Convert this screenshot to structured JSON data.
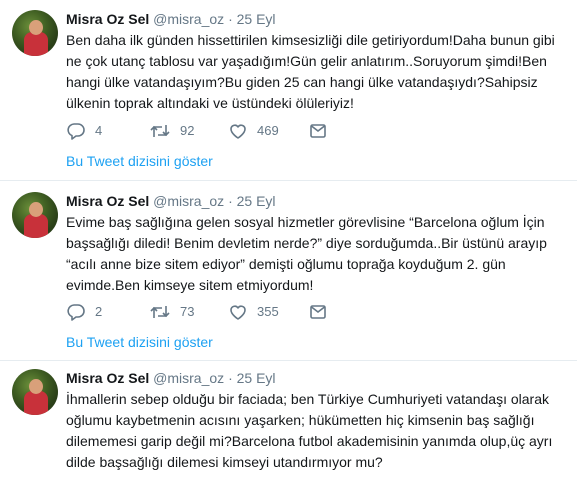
{
  "tweets": [
    {
      "name": "Misra Oz Sel",
      "handle": "@misra_oz",
      "dot": "·",
      "date": "25 Eyl",
      "lines": [
        "Ben daha ilk günden hissettirilen kimsesizliği dile getiriyordum!Daha bunun gibi",
        "ne çok utanç tablosu var yaşadığım!Gün gelir anlatırım..Soruyorum şimdi!Ben",
        "hangi ülke vatandaşıyım?Bu giden 25 can hangi ülke vatandaşıydı?Sahipsiz",
        "ülkenin toprak altındaki ve üstündeki ölüleriyiz!"
      ],
      "replies": "4",
      "retweets": "92",
      "likes": "469",
      "thread_link": "Bu Tweet dizisini göster"
    },
    {
      "name": "Misra Oz Sel",
      "handle": "@misra_oz",
      "dot": "·",
      "date": "25 Eyl",
      "lines": [
        "Evime baş sağlığına gelen sosyal hizmetler görevlisine “Barcelona oğlum İçin",
        "başsağlığı diledi! Benim devletim nerde?” diye sorduğumda..Bir üstünü arayıp",
        "“acılı anne bize sitem ediyor” demişti oğlumu toprağa koyduğum 2. gün",
        "evimde.Ben kimseye sitem etmiyordum!"
      ],
      "replies": "2",
      "retweets": "73",
      "likes": "355",
      "thread_link": "Bu Tweet dizisini göster"
    },
    {
      "name": "Misra Oz Sel",
      "handle": "@misra_oz",
      "dot": "·",
      "date": "25 Eyl",
      "lines": [
        "İhmallerin sebep olduğu bir faciada; ben Türkiye Cumhuriyeti vatandaşı olarak",
        "oğlumu kaybetmenin acısını yaşarken; hükümetten hiç kimsenin baş sağlığı",
        "dilememesi garip değil mi?Barcelona futbol akademisinin yanımda olup,üç ayrı",
        "dilde başsağlığı dilemesi kimseyi utandırmıyor mu?"
      ]
    }
  ],
  "icons": {
    "reply": "reply-icon",
    "retweet": "retweet-icon",
    "like": "heart-icon",
    "dm": "direct-message-icon"
  },
  "colors": {
    "text": "#14171a",
    "meta": "#657786",
    "link": "#1da1f2",
    "divider": "#e6ecf0"
  }
}
